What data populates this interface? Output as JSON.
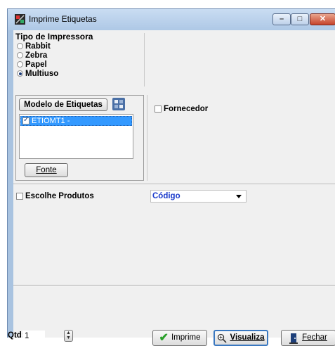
{
  "window": {
    "title": "Imprime Etiquetas"
  },
  "printer_type": {
    "title": "Tipo de Impressora",
    "options": [
      "Rabbit",
      "Zebra",
      "Papel",
      "Multiuso"
    ],
    "selected": "Multiuso"
  },
  "labels": {
    "button": "Modelo de Etiquetas",
    "items": [
      {
        "text": "ETIOMT1 -",
        "checked": true
      }
    ],
    "fonte_button": "Fonte"
  },
  "fornecedor": {
    "label": "Fornecedor",
    "checked": false
  },
  "products": {
    "label": "Escolhe Produtos",
    "checked": false,
    "sort_value": "Código"
  },
  "footer": {
    "qtd_label": "Qtd:",
    "qtd_value": "1",
    "imprime": "Imprime",
    "visualiza": "Visualiza",
    "fechar": "Fechar"
  },
  "colors": {
    "selected_item": "#3399ff",
    "select_text": "#1a3acb"
  }
}
